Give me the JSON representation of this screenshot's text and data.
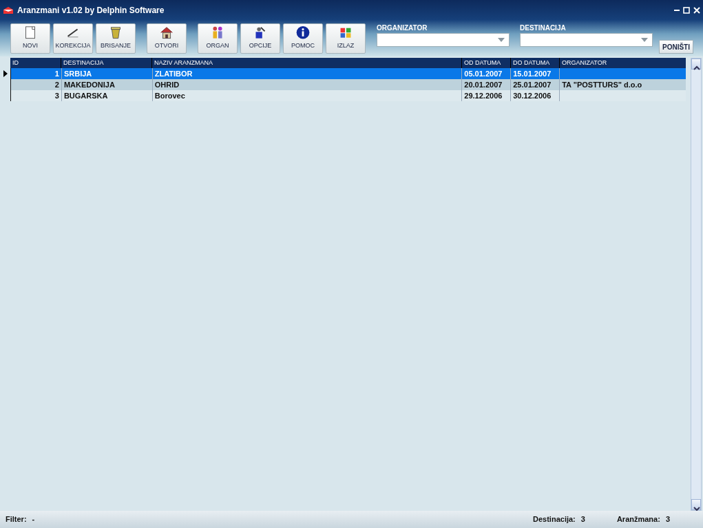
{
  "window": {
    "title": "Aranzmani v1.02 by Delphin  Software"
  },
  "toolbar": {
    "groups": [
      [
        {
          "label": "NOVI"
        },
        {
          "label": "KOREKCIJA"
        },
        {
          "label": "BRISANJE"
        }
      ],
      [
        {
          "label": "OTVORI"
        }
      ],
      [
        {
          "label": "ORGAN"
        },
        {
          "label": "OPCIJE"
        },
        {
          "label": "POMOC"
        },
        {
          "label": "IZLAZ"
        }
      ]
    ]
  },
  "filters": [
    {
      "label": "ORGANIZATOR"
    },
    {
      "label": "DESTINACIJA"
    }
  ],
  "reset_button": "PONIŠTI",
  "table": {
    "columns": [
      "ID",
      "DESTINACIJA",
      "NAZIV ARANZMANA",
      "OD DATUMA",
      "DO DATUMA",
      "ORGANIZATOR"
    ],
    "rows": [
      {
        "selected": true,
        "cells": [
          "1",
          "SRBIJA",
          "ZLATIBOR",
          "05.01.2007",
          "15.01.2007",
          ""
        ]
      },
      {
        "selected": false,
        "cells": [
          "2",
          "MAKEDONIJA",
          "OHRID",
          "20.01.2007",
          "25.01.2007",
          "TA \"POSTTURS\" d.o.o"
        ]
      },
      {
        "selected": false,
        "cells": [
          "3",
          "BUGARSKA",
          "Borovec",
          "29.12.2006",
          "30.12.2006",
          ""
        ]
      }
    ]
  },
  "status_bar": {
    "filter_label": "Filter:",
    "filter_value": "-",
    "items": [
      {
        "label": "Destinacija:",
        "value": "3"
      },
      {
        "label": "Aranžmana:",
        "value": "3"
      }
    ]
  }
}
